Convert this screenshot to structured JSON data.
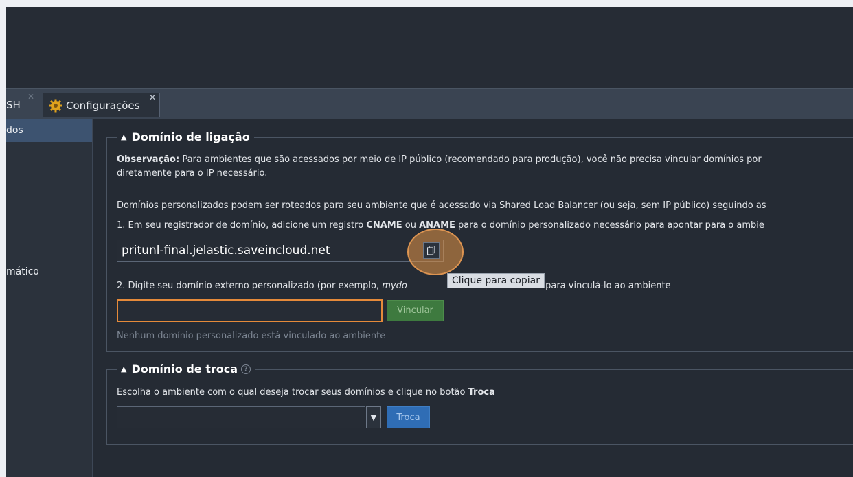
{
  "tabs": {
    "ssh_label": "SH",
    "ssh_close": "✕",
    "config_label": "Configurações",
    "config_close": "✕"
  },
  "sidebar": {
    "active_item": "dos",
    "item_automatic": "mático"
  },
  "binding_section": {
    "title": "Domínio de ligação",
    "note_bold": "Observação:",
    "note_text_1": " Para ambientes que são acessados por meio de ",
    "note_link": "IP público",
    "note_text_2": " (recomendado para produção), você não precisa vincular domínios por",
    "note_line2": "diretamente para o IP necessário.",
    "custom_link": "Domínios personalizados",
    "custom_text_1": " podem ser roteados para seu ambiente que é acessado via ",
    "slb_link": "Shared Load Balancer",
    "custom_text_2": " (ou seja, sem IP público) seguindo as",
    "step1_text_1": "1. Em seu registrador de domínio, adicione um registro ",
    "step1_cname": "CNAME",
    "step1_or": " ou ",
    "step1_aname": "ANAME",
    "step1_text_2": " para o domínio personalizado necessário para apontar para o ambie",
    "env_domain_value": "pritunl-final.jelastic.saveincloud.net",
    "copy_tooltip": "Clique para copiar",
    "step2_text_1": "2. Digite seu domínio externo personalizado (por exemplo, ",
    "step2_example": "mydo",
    "step2_text_2": " abaixo para vinculá-lo ao ambiente",
    "custom_domain_value": "",
    "bind_button": "Vincular",
    "no_domain_text": "Nenhum domínio personalizado está vinculado ao ambiente"
  },
  "swap_section": {
    "title": "Domínio de troca",
    "help_icon": "?",
    "instruction_1": "Escolha o ambiente com o qual deseja trocar seus domínios e clique no botão ",
    "instruction_bold": "Troca",
    "selected_env": "",
    "swap_button": "Troca"
  },
  "colors": {
    "accent_orange": "#e58a3a",
    "bind_green": "#3e7a3f",
    "swap_blue": "#2f6db5"
  }
}
